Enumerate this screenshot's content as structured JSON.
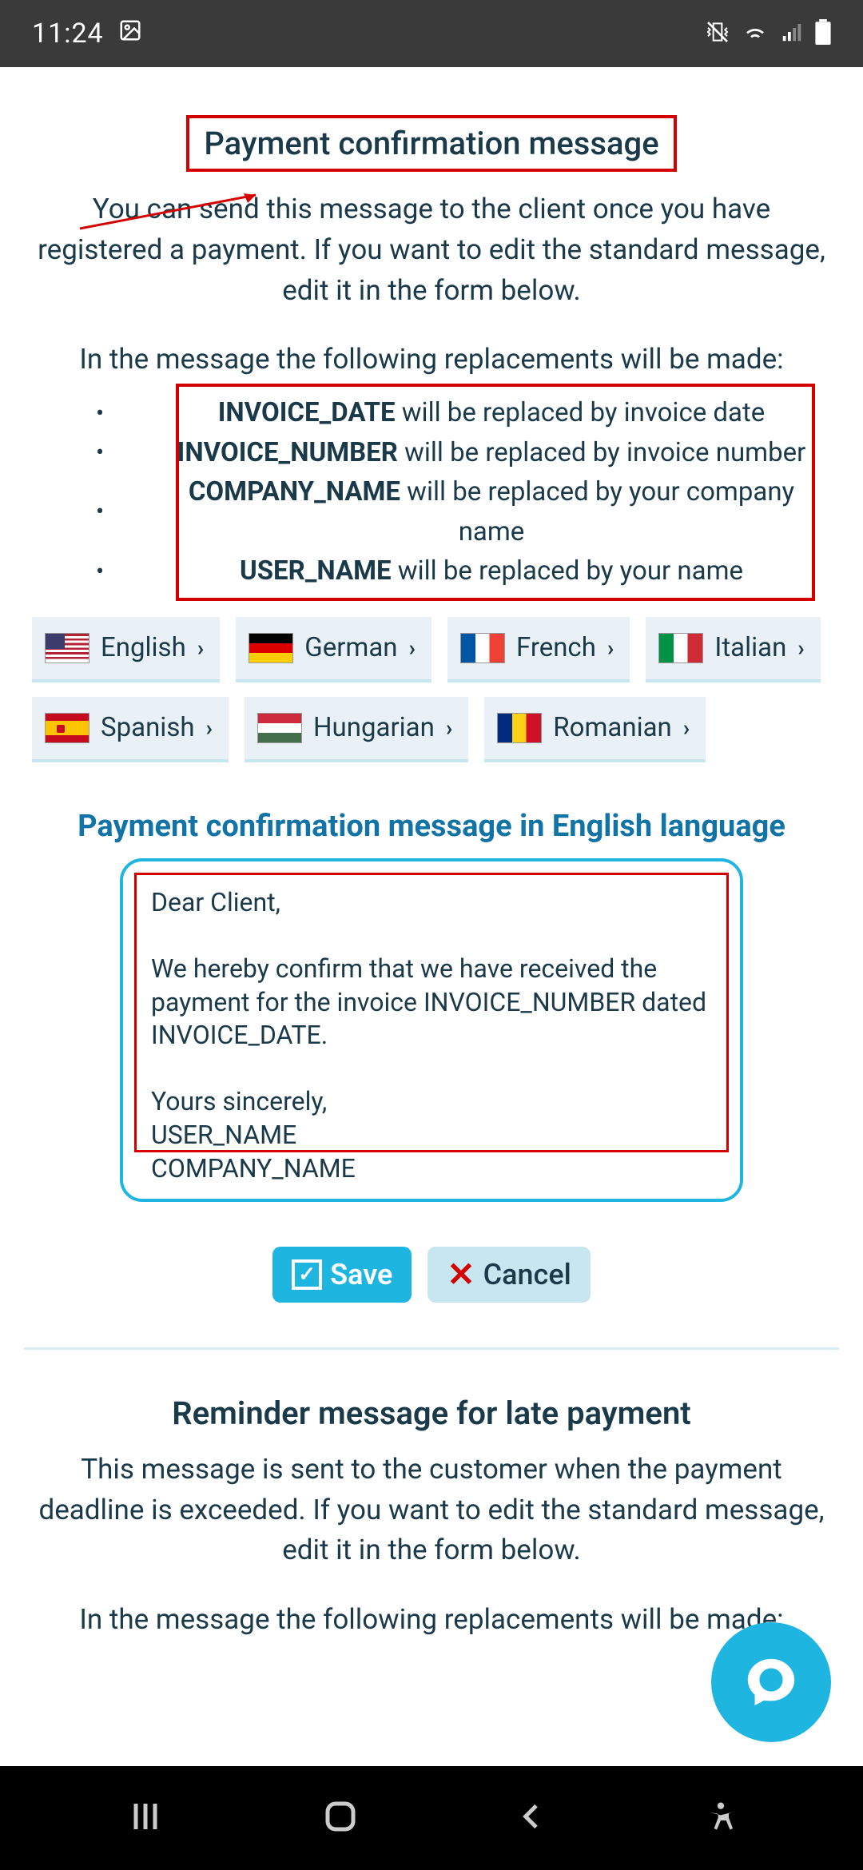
{
  "status": {
    "time": "11:24"
  },
  "section1": {
    "title": "Payment confirmation message",
    "desc": "You can send this message to the client once you have registered a payment. If you want to edit the standard message, edit it in the form below.",
    "desc2": "In the message the following replacements will be made:",
    "replacements": [
      {
        "token": "INVOICE_DATE",
        "text": " will be replaced by invoice date"
      },
      {
        "token": "INVOICE_NUMBER",
        "text": " will be replaced by invoice number"
      },
      {
        "token": "COMPANY_NAME",
        "text": " will be replaced by your company name"
      },
      {
        "token": "USER_NAME",
        "text": " will be replaced by your name"
      }
    ]
  },
  "languages": {
    "english": "English",
    "german": "German",
    "french": "French",
    "italian": "Italian",
    "spanish": "Spanish",
    "hungarian": "Hungarian",
    "romanian": "Romanian"
  },
  "editor": {
    "title": "Payment confirmation message in English language",
    "body": "Dear Client,\n\nWe hereby confirm that we have received the payment for the invoice INVOICE_NUMBER dated INVOICE_DATE.\n\nYours sincerely,\nUSER_NAME\nCOMPANY_NAME"
  },
  "actions": {
    "save": "Save",
    "cancel": "Cancel"
  },
  "section2": {
    "title": "Reminder message for late payment",
    "desc": "This message is sent to the customer when the payment deadline is exceeded. If you want to edit the standard message, edit it in the form below.",
    "desc2": "In the message the following replacements will be made:"
  }
}
